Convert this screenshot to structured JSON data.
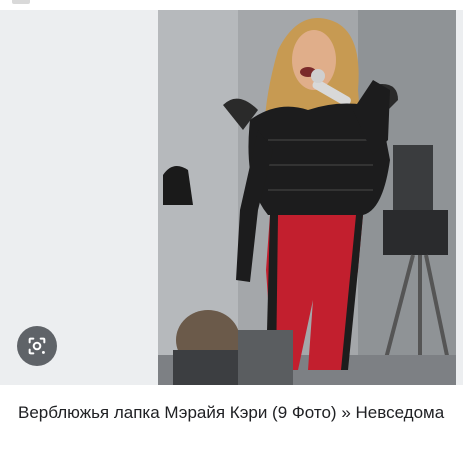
{
  "caption": {
    "title": "Верблюжья лапка Мэрайя Кэри (9 Фото) » Невседома"
  },
  "icons": {
    "lens": "google-lens-icon"
  },
  "colors": {
    "lens_button_bg": "#5f6368",
    "caption_text": "#202124",
    "side_panel_bg": "#eceef0"
  }
}
